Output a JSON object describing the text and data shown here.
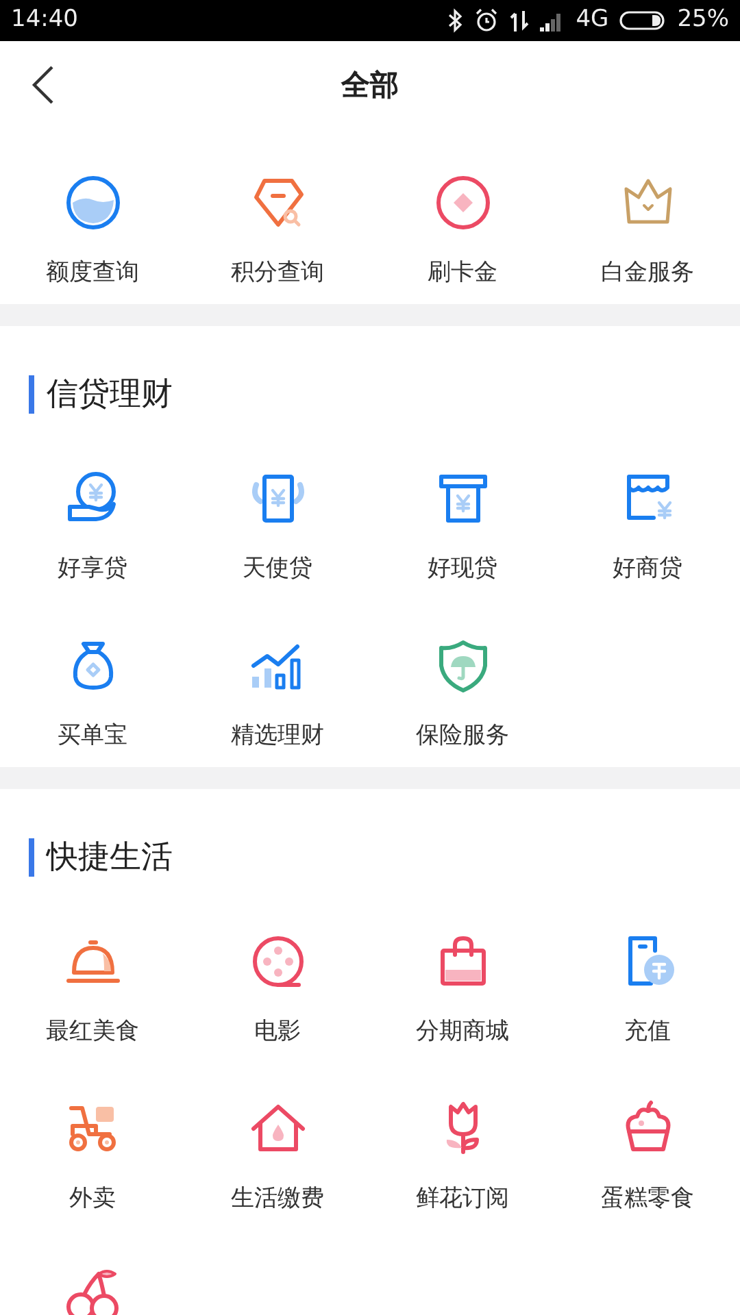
{
  "status_bar": {
    "time": "14:40",
    "network": "4G",
    "battery": "25%"
  },
  "header": {
    "title": "全部"
  },
  "top_items": [
    {
      "label": "额度查询"
    },
    {
      "label": "积分查询"
    },
    {
      "label": "刷卡金"
    },
    {
      "label": "白金服务"
    }
  ],
  "sections": [
    {
      "title": "信贷理财",
      "items": [
        {
          "kind": "tile",
          "label": "好享贷"
        },
        {
          "kind": "tile",
          "label": "天使贷"
        },
        {
          "kind": "tile",
          "label": "好现贷"
        },
        {
          "kind": "tile",
          "label": "好商贷"
        },
        {
          "kind": "tile",
          "label": "买单宝"
        },
        {
          "kind": "tile",
          "label": "精选理财"
        },
        {
          "kind": "tile",
          "label": "保险服务"
        }
      ]
    },
    {
      "title": "快捷生活",
      "items": [
        {
          "kind": "tile",
          "label": "最红美食"
        },
        {
          "kind": "tile",
          "label": "电影"
        },
        {
          "kind": "tile",
          "label": "分期商城"
        },
        {
          "kind": "tile",
          "label": "充值"
        },
        {
          "kind": "tile",
          "label": "外卖"
        },
        {
          "kind": "tile",
          "label": "生活缴费"
        },
        {
          "kind": "tile",
          "label": "鲜花订阅"
        },
        {
          "kind": "tile",
          "label": "蛋糕零食"
        },
        {
          "kind": "icon_only"
        }
      ]
    }
  ]
}
